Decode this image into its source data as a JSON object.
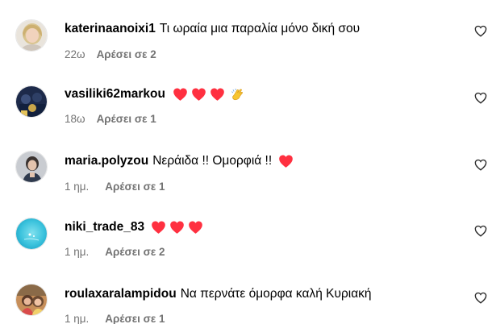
{
  "comments": [
    {
      "username": "katerinaanoixi1",
      "text": "Τι ωραία μια παραλία μόνο δική σου",
      "time": "22ω",
      "likes": "Αρέσει σε 2",
      "avatar": "avatar-blonde-woman",
      "emojis": []
    },
    {
      "username": "vasiliki62markou",
      "text": "",
      "time": "18ω",
      "likes": "Αρέσει σε 1",
      "avatar": "avatar-dark-group",
      "emojis": [
        "red-heart",
        "red-heart",
        "red-heart",
        "clapping-hands"
      ]
    },
    {
      "username": "maria.polyzou",
      "text": "Νεράιδα !! Ομορφιά !!",
      "time": "1 ημ.",
      "likes": "Αρέσει σε 1",
      "avatar": "avatar-woman-portrait",
      "emojis": [
        "red-heart"
      ]
    },
    {
      "username": "niki_trade_83",
      "text": "",
      "time": "1 ημ.",
      "likes": "Αρέσει σε 2",
      "avatar": "avatar-turquoise-sea",
      "emojis": [
        "red-heart",
        "red-heart",
        "red-heart"
      ]
    },
    {
      "username": "roulaxaralampidou",
      "text": "Να περνάτε όμορφα καλή Κυριακή",
      "time": "1 ημ.",
      "likes": "Αρέσει σε 1",
      "avatar": "avatar-two-women",
      "emojis": []
    }
  ],
  "colors": {
    "heart": "#ff3040",
    "muted": "#737373",
    "text": "#000000"
  }
}
